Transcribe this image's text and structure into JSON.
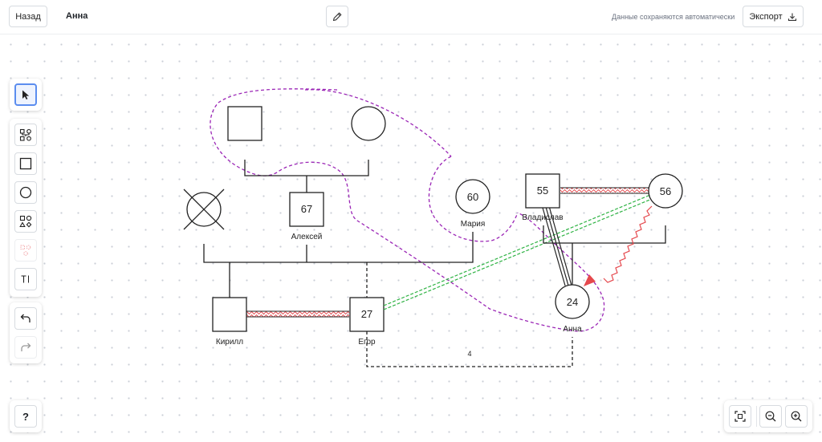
{
  "header": {
    "back_label": "Назад",
    "title": "Анна",
    "autosave_text": "Данные сохраняются автоматически",
    "export_label": "Экспорт"
  },
  "toolbar": {
    "tools": [
      "select-pointer-icon",
      "family-tree-icon",
      "square-icon",
      "circle-icon",
      "shapes-icon",
      "emotional-relations-icon",
      "text-icon"
    ],
    "history": [
      "undo-icon",
      "redo-icon"
    ],
    "help_label": "?"
  },
  "zoom": {
    "controls": [
      "fit-screen-icon",
      "zoom-out-icon",
      "zoom-in-icon"
    ]
  },
  "colors": {
    "accent": "#5b8def",
    "boundary": "#9b26b6",
    "conflict_red": "#e5484d",
    "distant_green": "#2fb344",
    "dotted_grid": "#c9ced6"
  },
  "genogram": {
    "people": [
      {
        "label": "Алексей",
        "age": "67",
        "shape": "square"
      },
      {
        "label": "Мария",
        "age": "60",
        "shape": "circle"
      },
      {
        "label": "Кирилл",
        "age": "",
        "shape": "square"
      },
      {
        "label": "Егор",
        "age": "27",
        "shape": "square"
      },
      {
        "label": "Владислав",
        "age": "55",
        "shape": "square"
      },
      {
        "label": "",
        "age": "56",
        "shape": "circle"
      },
      {
        "label": "Анна",
        "age": "24",
        "shape": "circle"
      }
    ],
    "connection_label": "4"
  }
}
